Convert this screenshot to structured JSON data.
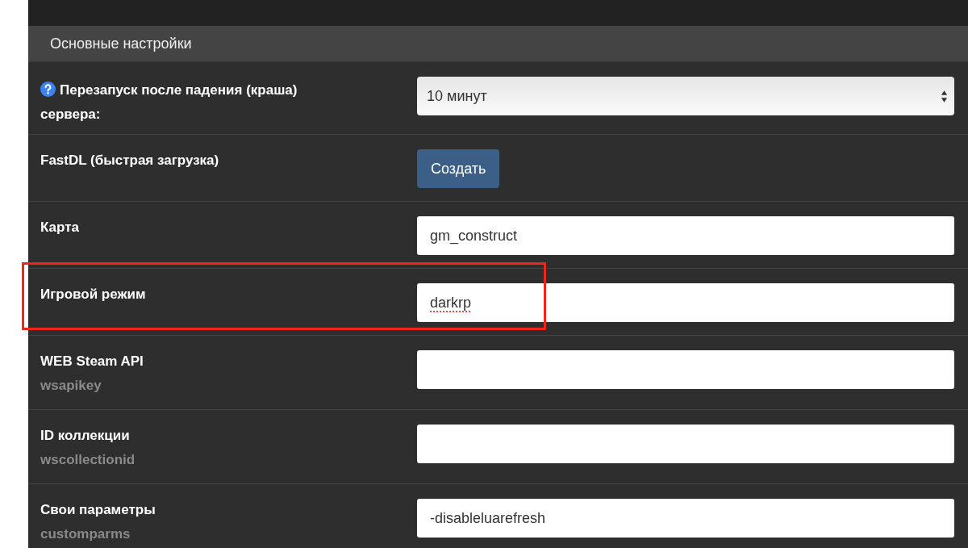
{
  "panel": {
    "title": "Основные настройки"
  },
  "settings": [
    {
      "label": "Перезапуск после падения (краша) сервера:",
      "help": true,
      "kind": "select",
      "value": "10 минут",
      "highlighted": false
    },
    {
      "label": "FastDL (быстрая загрузка)",
      "help": false,
      "kind": "button",
      "value": "Создать",
      "highlighted": false
    },
    {
      "label": "Карта",
      "help": false,
      "kind": "input",
      "value": "gm_construct",
      "highlighted": false
    },
    {
      "label": "Игровой режим",
      "help": false,
      "kind": "input",
      "value": "darkrp",
      "misspelled": true,
      "highlighted": true
    },
    {
      "label": "WEB Steam API",
      "sublabel": "wsapikey",
      "help": false,
      "kind": "input",
      "highlighted": false
    },
    {
      "label": "ID коллекции",
      "sublabel": "wscollectionid",
      "help": false,
      "kind": "input",
      "highlighted": false
    },
    {
      "label": "Свои параметры",
      "sublabel": "customparms",
      "help": false,
      "kind": "input",
      "value": "-disableluarefresh",
      "highlighted": false
    }
  ]
}
